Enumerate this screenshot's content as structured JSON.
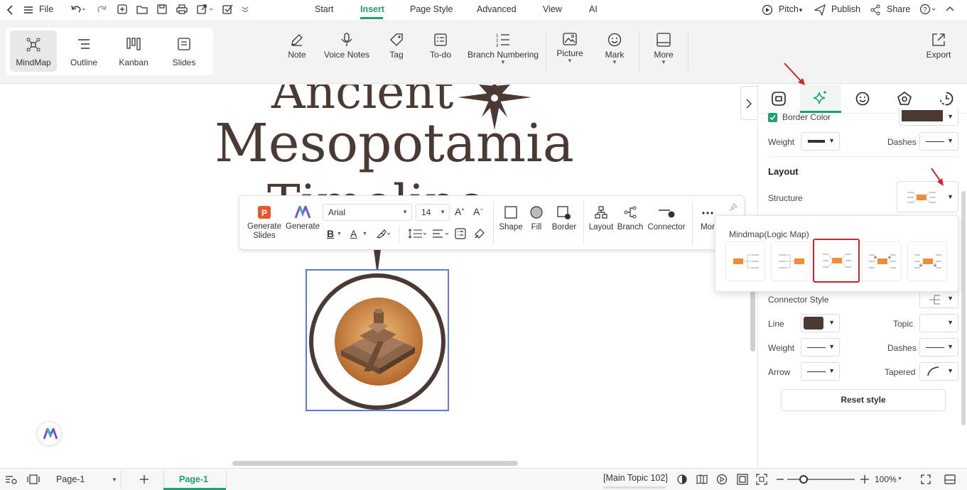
{
  "menubar": {
    "file": "File",
    "tabs": [
      "Start",
      "Insert",
      "Page Style",
      "Advanced",
      "View",
      "AI"
    ],
    "active_tab": "Insert",
    "pitch": "Pitch",
    "publish": "Publish",
    "share": "Share"
  },
  "ribbon": {
    "views": [
      "MindMap",
      "Outline",
      "Kanban",
      "Slides"
    ],
    "tools": [
      "Note",
      "Voice Notes",
      "Tag",
      "To-do",
      "Branch Numbering",
      "Picture",
      "Mark",
      "More"
    ],
    "export": "Export"
  },
  "canvas": {
    "title_line1": "Ancient",
    "title_line2": "Mesopotamia",
    "title_line3": "Timeline"
  },
  "floating_toolbar": {
    "generate_slides": "Generate\nSlides",
    "generate": "Generate",
    "font": "Arial",
    "size": "14",
    "shape": "Shape",
    "fill": "Fill",
    "border": "Border",
    "layout": "Layout",
    "branch": "Branch",
    "connector": "Connector",
    "more": "Mor"
  },
  "panel": {
    "border_color": "Border Color",
    "weight": "Weight",
    "dashes": "Dashes",
    "layout_heading": "Layout",
    "structure": "Structure",
    "connector_style": "Connector Style",
    "line": "Line",
    "topic": "Topic",
    "weight2": "Weight",
    "dashes2": "Dashes",
    "arrow": "Arrow",
    "tapered": "Tapered",
    "reset": "Reset style"
  },
  "popup": {
    "title": "Mindmap(Logic Map)"
  },
  "status": {
    "page_select": "Page-1",
    "page_tab": "Page-1",
    "topic_info": "[Main Topic 102]",
    "zoom": "100%"
  },
  "colors": {
    "accent": "#1aa36f",
    "brown": "#4a3a33",
    "orange": "#f28c38",
    "selection_red": "#c6262e",
    "selection_blue": "#5b7bd5"
  }
}
